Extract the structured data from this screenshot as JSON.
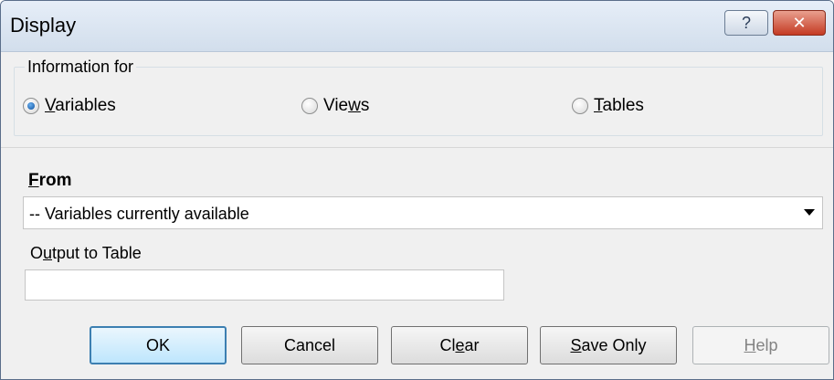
{
  "window": {
    "title": "Display",
    "help_glyph": "?",
    "close_glyph": "✕"
  },
  "info_group": {
    "legend": "Information for",
    "options": [
      {
        "prefix": "",
        "mnemonic": "V",
        "rest": "ariables",
        "checked": true
      },
      {
        "prefix": "Vie",
        "mnemonic": "w",
        "rest": "s",
        "checked": false
      },
      {
        "prefix": "",
        "mnemonic": "T",
        "rest": "ables",
        "checked": false
      }
    ]
  },
  "from": {
    "label_mnemonic": "F",
    "label_rest": "rom",
    "selected": "-- Variables currently available"
  },
  "output": {
    "label_prefix": "O",
    "label_mnemonic": "u",
    "label_rest": "tput to Table",
    "value": ""
  },
  "buttons": {
    "ok": "OK",
    "cancel": "Cancel",
    "clear_prefix": "Cl",
    "clear_mnemonic": "e",
    "clear_rest": "ar",
    "save_mnemonic": "S",
    "save_rest": "ave Only",
    "help_mnemonic": "H",
    "help_rest": "elp"
  },
  "colors": {
    "accent": "#3c7fb1",
    "radio_checked": "#0d4f9c",
    "close_button": "#c43a23"
  }
}
